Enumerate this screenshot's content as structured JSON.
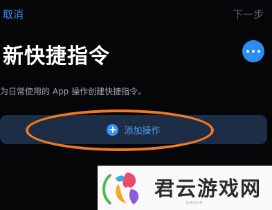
{
  "nav": {
    "cancel": "取消",
    "next": "下一步"
  },
  "title": "新快捷指令",
  "description": "为日常使用的 App 操作创建快捷指令。",
  "add_action": {
    "label": "添加操作",
    "icon": "plus-circle-icon"
  },
  "more_icon": "ellipsis-icon",
  "colors": {
    "accent": "#3d8ef7",
    "background": "#050608",
    "button_bg": "#1c2d45",
    "highlight": "#ef7a22"
  },
  "watermark": {
    "text": "君云游戏网",
    "sub": "junyun"
  }
}
